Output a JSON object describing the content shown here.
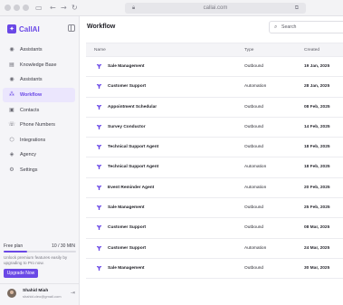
{
  "browser": {
    "url": "callai.com"
  },
  "sidebar": {
    "brand": "CallAI",
    "items": [
      {
        "label": "Assistants",
        "icon": "user-icon",
        "glyph": "◉",
        "active": false
      },
      {
        "label": "Knowledge Base",
        "icon": "book-icon",
        "glyph": "▤",
        "active": false
      },
      {
        "label": "Assistants",
        "icon": "user-icon",
        "glyph": "◉",
        "active": false
      },
      {
        "label": "Workflow",
        "icon": "workflow-icon",
        "glyph": "⁂",
        "active": true
      },
      {
        "label": "Contacts",
        "icon": "contacts-icon",
        "glyph": "▣",
        "active": false
      },
      {
        "label": "Phone Numbers",
        "icon": "phone-icon",
        "glyph": "☏",
        "active": false
      },
      {
        "label": "Integrations",
        "icon": "integrations-icon",
        "glyph": "⬡",
        "active": false
      },
      {
        "label": "Agency",
        "icon": "agency-icon",
        "glyph": "◈",
        "active": false
      },
      {
        "label": "Settings",
        "icon": "gear-icon",
        "glyph": "⚙",
        "active": false
      }
    ],
    "plan": {
      "label": "Free plan",
      "usage_text": "10 / 30 MIN",
      "usage_fraction": 0.33,
      "note": "Unlock premium features easily by upgrading to Pro now.",
      "upgrade_label": "Upgrade Now"
    },
    "user": {
      "name": "Shahid Miah",
      "email": "shahid.cleo@gmail.com"
    }
  },
  "main": {
    "title": "Workflow",
    "search": {
      "placeholder": "Search",
      "value": ""
    },
    "columns": {
      "name": "Name",
      "type": "Type",
      "created": "Created"
    },
    "rows": [
      {
        "name": "Sale Management",
        "type": "Outbound",
        "created": "19 Jan, 2025"
      },
      {
        "name": "Customer Support",
        "type": "Automation",
        "created": "28 Jan, 2025"
      },
      {
        "name": "Appointment Schedular",
        "type": "Outbound",
        "created": "08 Feb, 2025"
      },
      {
        "name": "Survey Conductor",
        "type": "Outbound",
        "created": "14 Feb, 2025"
      },
      {
        "name": "Technical Support Agent",
        "type": "Outbound",
        "created": "18 Feb, 2025"
      },
      {
        "name": "Technical Support Agent",
        "type": "Automation",
        "created": "18 Feb, 2025"
      },
      {
        "name": "Event Reminder Agent",
        "type": "Automation",
        "created": "20 Feb, 2025"
      },
      {
        "name": "Sale Management",
        "type": "Outbound",
        "created": "25 Feb, 2025"
      },
      {
        "name": "Customer Support",
        "type": "Outbound",
        "created": "08 Mar, 2025"
      },
      {
        "name": "Customer Support",
        "type": "Automation",
        "created": "24 Mar, 2025"
      },
      {
        "name": "Sale Management",
        "type": "Outbound",
        "created": "30 Mar, 2025"
      }
    ]
  },
  "colors": {
    "accent": "#6a48e6",
    "active_bg": "#ebe6fd"
  }
}
